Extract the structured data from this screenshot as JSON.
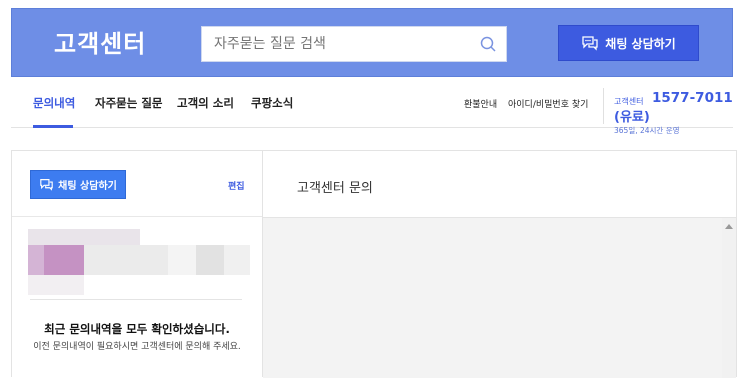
{
  "header": {
    "title": "고객센터",
    "search": {
      "value": "자주묻는 질문 검색",
      "placeholder": "자주묻는 질문 검색"
    },
    "chat_button": "채팅 상담하기"
  },
  "nav": {
    "tabs": [
      {
        "label": "문의내역",
        "active": true
      },
      {
        "label": "자주묻는 질문",
        "active": false
      },
      {
        "label": "고객의 소리",
        "active": false
      },
      {
        "label": "쿠팡소식",
        "active": false
      }
    ],
    "links": [
      "환불안내",
      "아이디/비밀번호 찾기"
    ],
    "phone": {
      "label": "고객센터",
      "number": "1577-7011",
      "paid": "(유료)",
      "hours": "365일, 24시간 운영"
    }
  },
  "left_panel": {
    "chat_button": "채팅 상담하기",
    "edit": "편집",
    "empty_title": "최근 문의내역을 모두 확인하셨습니다.",
    "empty_desc": "이전 문의내역이 필요하시면 고객센터에 문의해 주세요."
  },
  "right_panel": {
    "title": "고객센터 문의"
  },
  "colors": {
    "banner": "#6e8ee6",
    "accent": "#3d5be0",
    "small_button": "#3d7cf0"
  }
}
